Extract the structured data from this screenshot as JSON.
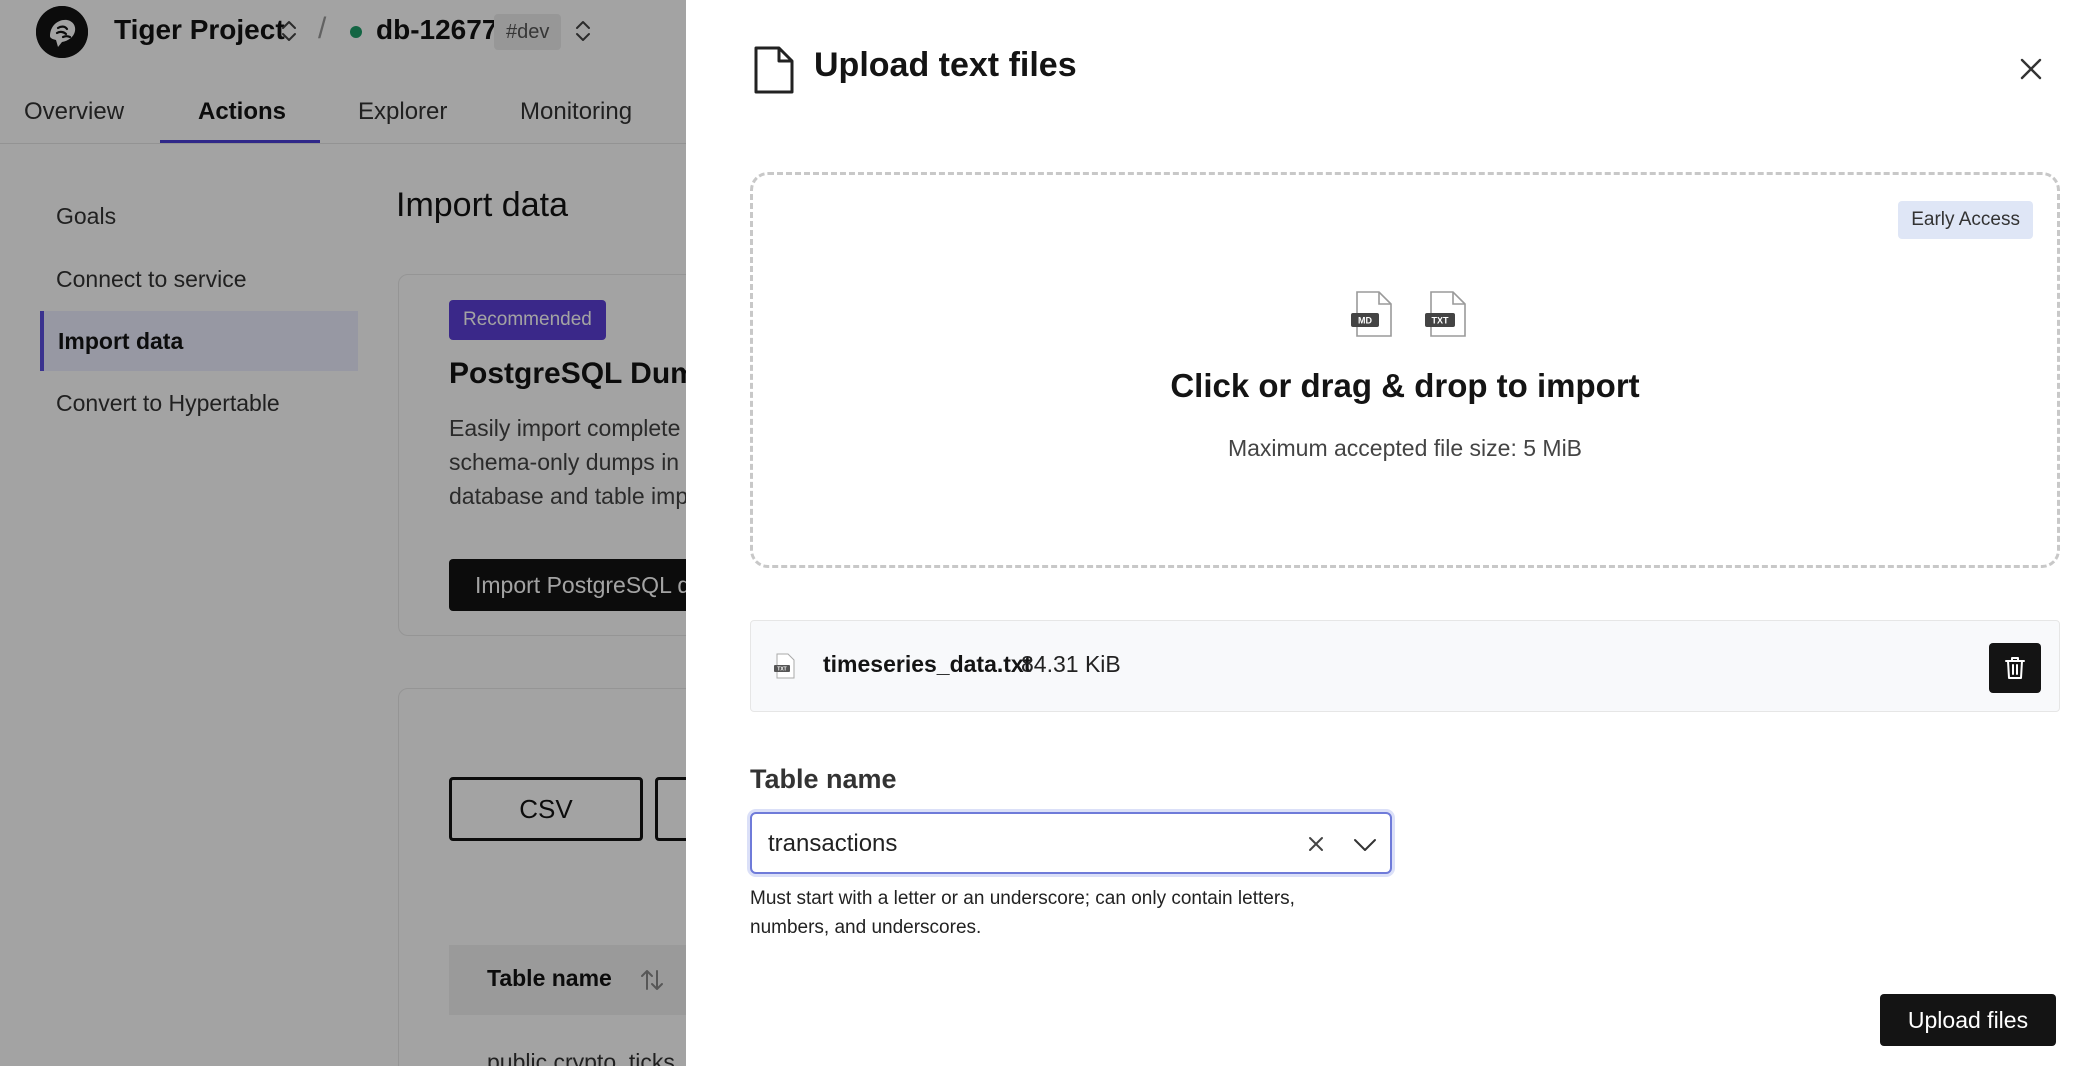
{
  "topbar": {
    "project_name": "Tiger Project",
    "separator": "/",
    "service_name": "db-12677",
    "env_badge": "#dev",
    "status_color": "#1e9e6a"
  },
  "tabs": [
    {
      "label": "Overview",
      "active": false
    },
    {
      "label": "Actions",
      "active": true
    },
    {
      "label": "Explorer",
      "active": false
    },
    {
      "label": "Monitoring",
      "active": false
    }
  ],
  "sidebar": {
    "items": [
      {
        "label": "Goals",
        "active": false
      },
      {
        "label": "Connect to service",
        "active": false
      },
      {
        "label": "Import data",
        "active": true
      },
      {
        "label": "Convert to Hypertable",
        "active": false
      }
    ]
  },
  "main": {
    "title": "Import data",
    "dump_card": {
      "badge": "Recommended",
      "title": "PostgreSQL Dump",
      "description_lines": [
        "Easily import complete",
        "schema-only dumps in",
        "database and table imp"
      ],
      "button": "Import PostgreSQL d"
    },
    "formats_card": {
      "csv_button": "CSV",
      "table_header": "Table name",
      "first_row": "public.crypto_ticks"
    }
  },
  "drawer": {
    "title": "Upload text files",
    "dropzone": {
      "badge": "Early Access",
      "icon_md_label": "MD",
      "icon_txt_label": "TXT",
      "title": "Click or drag & drop to import",
      "subtitle": "Maximum accepted file size: 5 MiB"
    },
    "file": {
      "name": "timeseries_data.txt",
      "size": "84.31 KiB",
      "icon_label": "TXT"
    },
    "table_name": {
      "label": "Table name",
      "value": "transactions",
      "help": "Must start with a letter or an underscore; can only contain letters, numbers, and underscores."
    },
    "upload_button": "Upload files"
  },
  "colors": {
    "accent": "#5b3fd6",
    "overlay": "rgba(0,0,0,0.36)",
    "primary_button": "#141414"
  }
}
